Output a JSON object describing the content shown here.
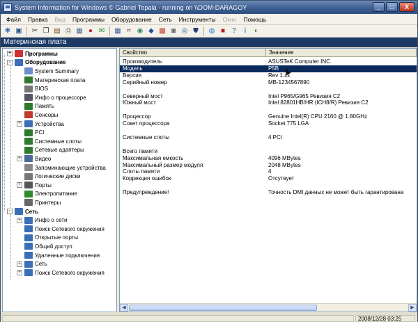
{
  "window": {
    "title": "System Information for Windows  © Gabriel Topala - running on \\\\DOM-DARAGOY",
    "controls": {
      "minimize": "_",
      "maximize": "□",
      "close": "X"
    }
  },
  "menu": {
    "items": [
      {
        "label": "Файл",
        "enabled": true
      },
      {
        "label": "Правка",
        "enabled": true
      },
      {
        "label": "Вид",
        "enabled": false
      },
      {
        "label": "Программы",
        "enabled": true
      },
      {
        "label": "Оборудование",
        "enabled": true
      },
      {
        "label": "Сеть",
        "enabled": true
      },
      {
        "label": "Инструменты",
        "enabled": true
      },
      {
        "label": "Окно",
        "enabled": false
      },
      {
        "label": "Помощь",
        "enabled": true
      }
    ]
  },
  "toolbar": {
    "buttons": [
      {
        "icon": "wrench-icon",
        "glyph": "✱",
        "color": "#3a6fb7"
      },
      {
        "icon": "save-icon",
        "glyph": "▣",
        "color": "#2a4f8a"
      },
      {
        "icon": "sep"
      },
      {
        "icon": "cut-icon",
        "glyph": "✂",
        "color": "#333"
      },
      {
        "icon": "copy-icon",
        "glyph": "❐",
        "color": "#333"
      },
      {
        "icon": "paste-icon",
        "glyph": "▤",
        "color": "#7a5a24"
      },
      {
        "icon": "print-icon",
        "glyph": "⎙",
        "color": "#555"
      },
      {
        "icon": "properties-icon",
        "glyph": "▦",
        "color": "#4a6a9a"
      },
      {
        "icon": "stop-icon",
        "glyph": "●",
        "color": "#d21e1e"
      },
      {
        "icon": "report-icon",
        "glyph": "✉",
        "color": "#2f8a2f"
      },
      {
        "icon": "sep"
      },
      {
        "icon": "grid-icon",
        "glyph": "▦",
        "color": "#3a5f9a"
      },
      {
        "icon": "network-icon",
        "glyph": "⌗",
        "color": "#444"
      },
      {
        "icon": "globe-icon",
        "glyph": "◉",
        "color": "#2e8b57"
      },
      {
        "icon": "hardware-icon",
        "glyph": "◆",
        "color": "#1e4f9a"
      },
      {
        "icon": "tools-icon",
        "glyph": "▩",
        "color": "#c03a2b"
      },
      {
        "icon": "cpu-icon",
        "glyph": "◙",
        "color": "#5a5a5a"
      },
      {
        "icon": "eye-icon",
        "glyph": "◎",
        "color": "#2b5fb0"
      },
      {
        "icon": "shield-icon",
        "glyph": "⛊",
        "color": "#2b3f7a"
      },
      {
        "icon": "sep"
      },
      {
        "icon": "world-icon",
        "glyph": "◍",
        "color": "#2a7fd4"
      },
      {
        "icon": "lock-icon",
        "glyph": "■",
        "color": "#b22222"
      },
      {
        "icon": "help-icon",
        "glyph": "?",
        "color": "#1f4fa8"
      },
      {
        "icon": "info-icon",
        "glyph": "i",
        "color": "#1f4fa8"
      },
      {
        "icon": "exit-icon",
        "glyph": "◐",
        "color": "#2d8a3a"
      }
    ]
  },
  "header": {
    "title": "Материнская плата"
  },
  "tree": {
    "nodes": [
      {
        "label": "Программы",
        "level": 0,
        "expander": "+",
        "bold": true,
        "icon": "programs-icon",
        "color": "#c33"
      },
      {
        "label": "Оборудование",
        "level": 0,
        "expander": "-",
        "bold": true,
        "icon": "hardware-icon",
        "color": "#3a6fb7"
      },
      {
        "label": "System Summary",
        "level": 1,
        "expander": "",
        "icon": "summary-icon",
        "color": "#6b8fc6"
      },
      {
        "label": "Материнская плата",
        "level": 1,
        "expander": "",
        "icon": "motherboard-icon",
        "color": "#2f7a2f"
      },
      {
        "label": "BIOS",
        "level": 1,
        "expander": "",
        "icon": "bios-icon",
        "color": "#777"
      },
      {
        "label": "Инфо о процессоре",
        "level": 1,
        "expander": "",
        "icon": "cpu-icon",
        "color": "#556"
      },
      {
        "label": "Память",
        "level": 1,
        "expander": "",
        "icon": "memory-icon",
        "color": "#2d7a2d"
      },
      {
        "label": "Сенсоры",
        "level": 1,
        "expander": "",
        "icon": "sensor-icon",
        "color": "#c0392b"
      },
      {
        "label": "Устройства",
        "level": 1,
        "expander": "+",
        "icon": "devices-icon",
        "color": "#3a6fb7"
      },
      {
        "label": "PCI",
        "level": 1,
        "expander": "",
        "icon": "pci-icon",
        "color": "#2f7a2f"
      },
      {
        "label": "Системные слоты",
        "level": 1,
        "expander": "",
        "icon": "slots-icon",
        "color": "#2f7a2f"
      },
      {
        "label": "Сетевые адаптеры",
        "level": 1,
        "expander": "",
        "icon": "network-adapter-icon",
        "color": "#2f7a2f"
      },
      {
        "label": "Видео",
        "level": 1,
        "expander": "+",
        "icon": "video-icon",
        "color": "#4a6a9a"
      },
      {
        "label": "Запоминающие устройства",
        "level": 1,
        "expander": "",
        "icon": "storage-icon",
        "color": "#888"
      },
      {
        "label": "Логические диски",
        "level": 1,
        "expander": "",
        "icon": "disk-icon",
        "color": "#777"
      },
      {
        "label": "Порты",
        "level": 1,
        "expander": "+",
        "icon": "ports-icon",
        "color": "#555"
      },
      {
        "label": "Электропитание",
        "level": 1,
        "expander": "",
        "icon": "power-icon",
        "color": "#2d8a2d"
      },
      {
        "label": "Принтеры",
        "level": 1,
        "expander": "",
        "icon": "printer-icon",
        "color": "#666"
      },
      {
        "label": "Сеть",
        "level": 0,
        "expander": "-",
        "bold": true,
        "icon": "network-icon",
        "color": "#3a6fb7"
      },
      {
        "label": "Инфо о сети",
        "level": 1,
        "expander": "+",
        "icon": "net-info-icon",
        "color": "#3a6fb7"
      },
      {
        "label": "Поиск Сетевого окружения",
        "level": 1,
        "expander": "",
        "icon": "net-search-icon",
        "color": "#3a6fb7"
      },
      {
        "label": "Открытые порты",
        "level": 1,
        "expander": "",
        "icon": "open-ports-icon",
        "color": "#3a6fb7"
      },
      {
        "label": "Общий доступ",
        "level": 1,
        "expander": "",
        "icon": "shares-icon",
        "color": "#3a6fb7"
      },
      {
        "label": "Удаленные подключения",
        "level": 1,
        "expander": "",
        "icon": "remote-icon",
        "color": "#3a6fb7"
      },
      {
        "label": "Сеть",
        "level": 1,
        "expander": "+",
        "icon": "net-icon",
        "color": "#3a6fb7"
      },
      {
        "label": "Поиск Сетевого окружения",
        "level": 1,
        "expander": "+",
        "icon": "net-search-icon",
        "color": "#3a6fb7"
      }
    ]
  },
  "list": {
    "columns": [
      "Свойство",
      "Значение"
    ],
    "rows": [
      {
        "property": "Производитель",
        "value": "ASUSTeK Computer INC."
      },
      {
        "property": "Модель",
        "value": "P5B",
        "selected": true
      },
      {
        "property": "Версия",
        "value": "Rev 1.xx"
      },
      {
        "property": "Серийный номер",
        "value": "MB-1234567890"
      },
      {
        "property": "",
        "value": ""
      },
      {
        "property": "Северный мост",
        "value": "Intel P965/G965 Ревизия C2"
      },
      {
        "property": "Южный мост",
        "value": "Intel 82801HB/HR (ICH8/R) Ревизия C2"
      },
      {
        "property": "",
        "value": ""
      },
      {
        "property": "Процессор",
        "value": "Genuine Intel(R) CPU 2160 @ 1.80GHz"
      },
      {
        "property": "Сокет процессора",
        "value": "Socket 775 LGA"
      },
      {
        "property": "",
        "value": ""
      },
      {
        "property": "Системные слоты",
        "value": "4 PCI"
      },
      {
        "property": "",
        "value": ""
      },
      {
        "property": "Всего памяти",
        "value": ""
      },
      {
        "property": "Максимальная емкость",
        "value": "4096 MBytes"
      },
      {
        "property": "Максимальный размер модуля",
        "value": "2048 MBytes"
      },
      {
        "property": "Слоты памяти",
        "value": "4"
      },
      {
        "property": "Коррекция ошибок",
        "value": "Отсутвует"
      },
      {
        "property": "",
        "value": ""
      },
      {
        "property": "Предупреждение!",
        "value": "Точность DMI данных не может быть гарантирована"
      }
    ]
  },
  "statusbar": {
    "timestamp": "2008/12/28 03:25"
  }
}
